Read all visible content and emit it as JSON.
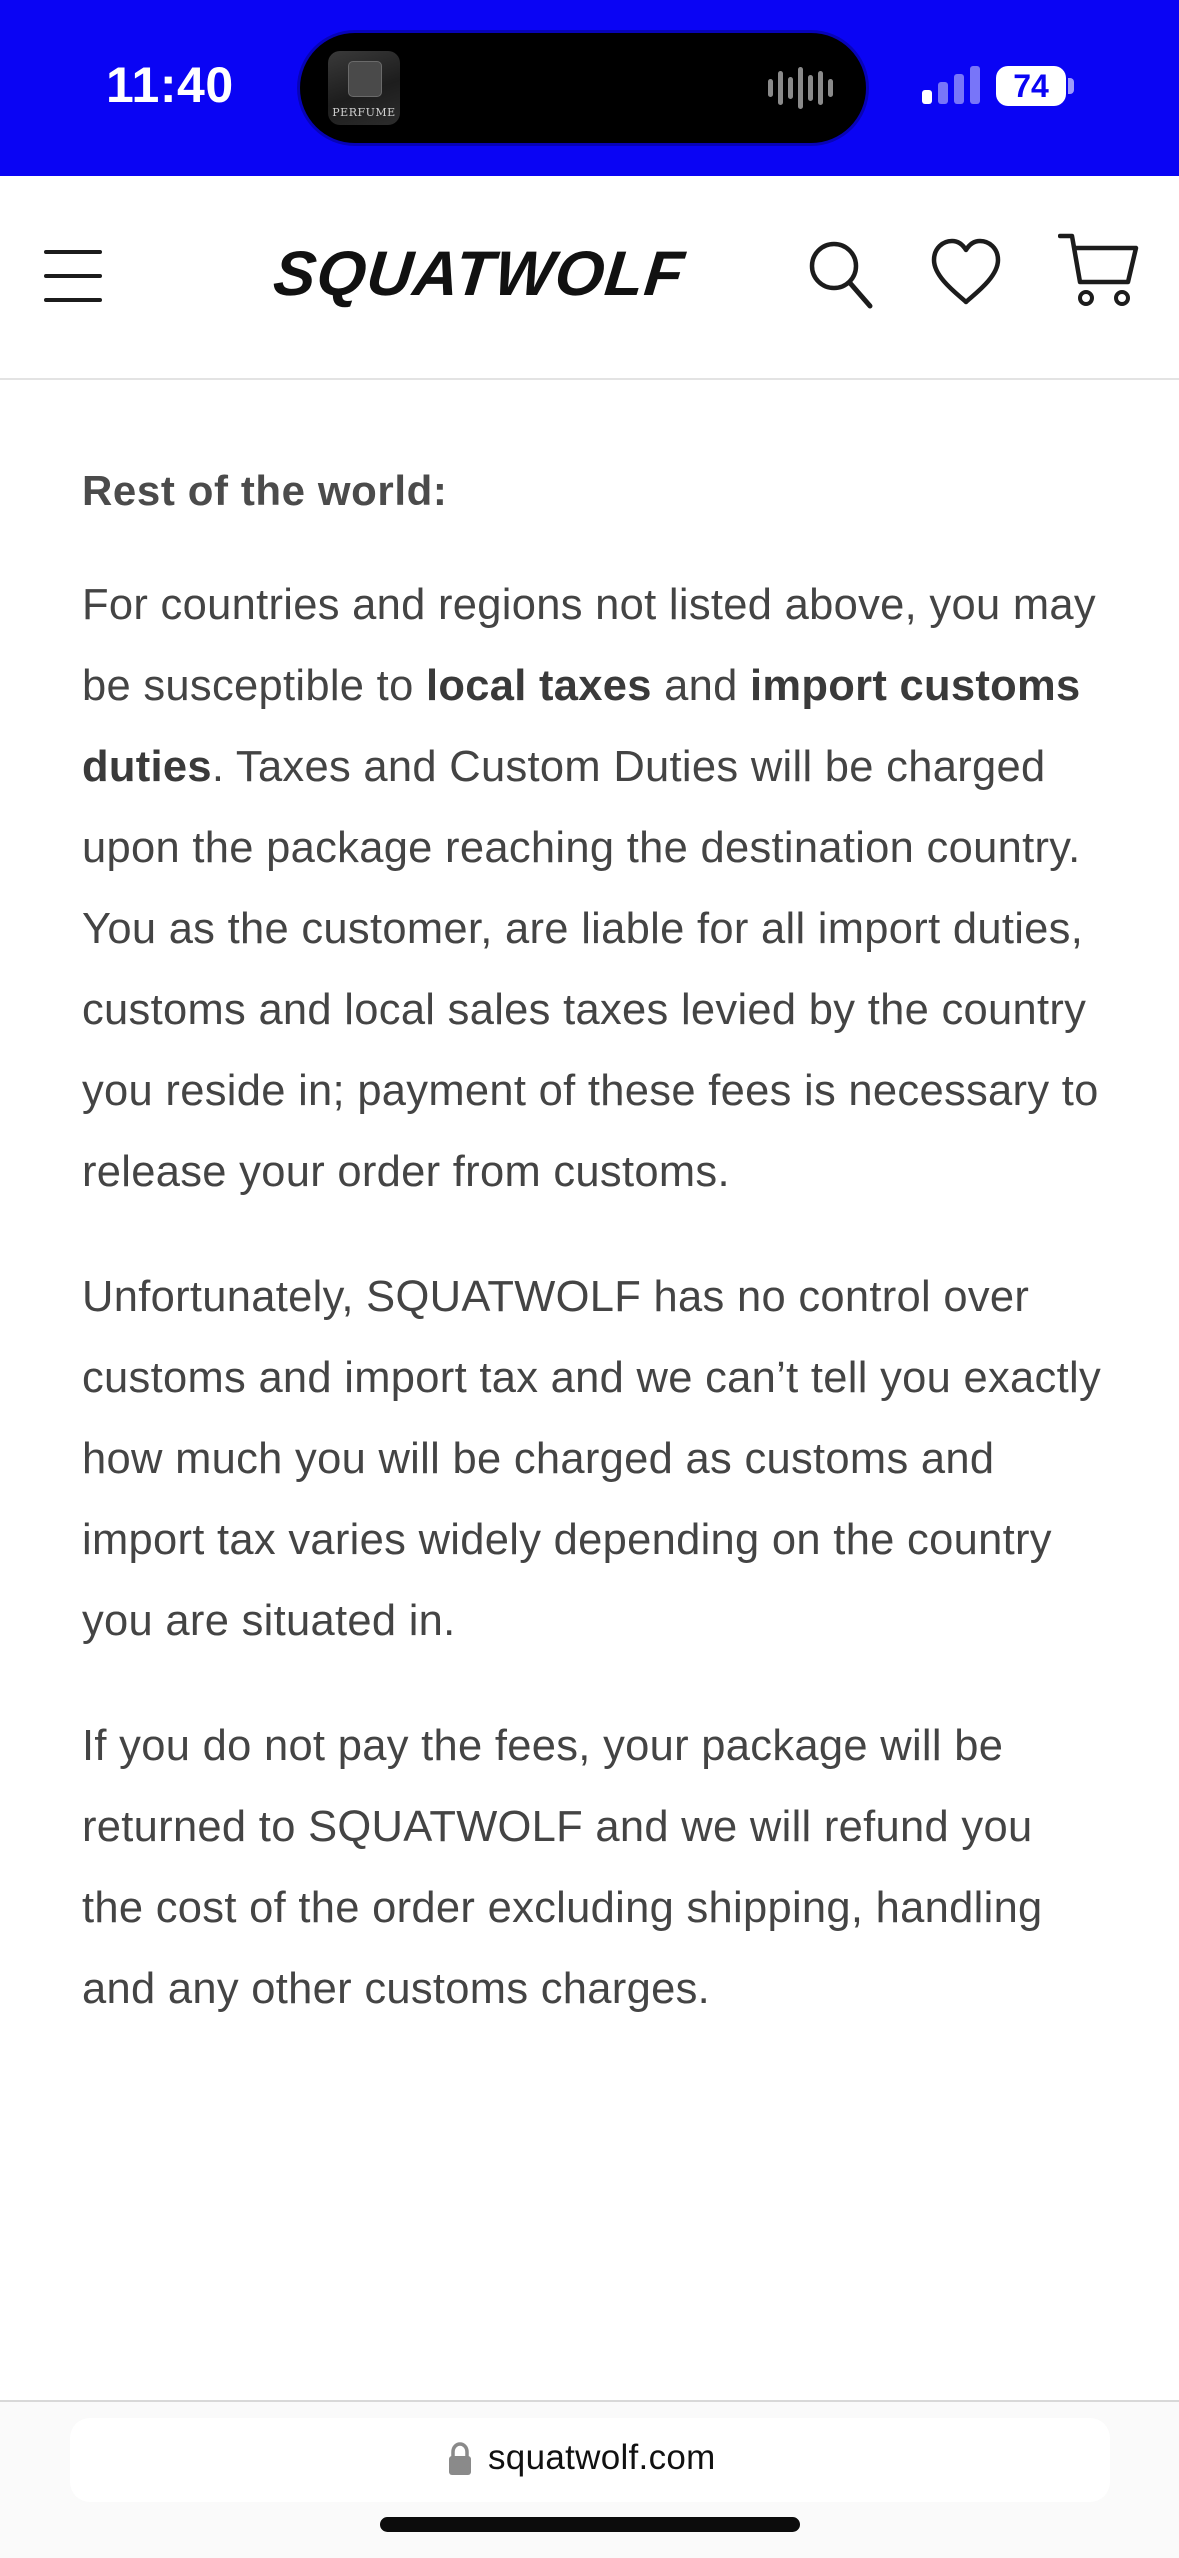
{
  "status_bar": {
    "time": "11:40",
    "battery_level": "74",
    "now_playing_art_label": "PERFUME",
    "background_color": "#0a04f4"
  },
  "header": {
    "logo_text": "SQUATWOLF",
    "menu_icon": "hamburger-menu-icon",
    "search_icon": "search-icon",
    "wishlist_icon": "heart-icon",
    "cart_icon": "cart-icon"
  },
  "content": {
    "heading": "Rest of the world:",
    "paragraph_1": {
      "part_1": "For countries and regions not listed above, you may be susceptible to ",
      "bold_1": "local taxes",
      "part_2": " and ",
      "bold_2": "import customs duties",
      "part_3": ". Taxes and Custom Duties will be charged upon the package reaching the destination country. You as the customer, are liable for all import duties, customs and local sales taxes levied by the country you reside in; payment of these fees is necessary to release your order from customs."
    },
    "paragraph_2": "Unfortunately, SQUATWOLF has no control over customs and import tax and we can’t tell you exactly how much you will be charged as customs and import tax varies widely depending on the country you are situated in.",
    "paragraph_3": "If you do not pay the fees, your package will be returned to SQUATWOLF and we will refund you the cost of the order excluding shipping, handling and any other customs charges."
  },
  "browser": {
    "url": "squatwolf.com",
    "secure_icon": "lock-icon"
  }
}
